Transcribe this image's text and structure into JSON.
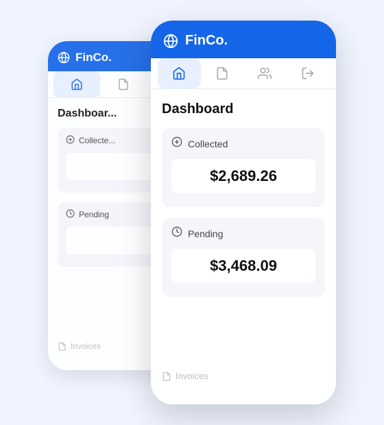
{
  "app": {
    "name": "FinCo.",
    "accent_color": "#1565e8"
  },
  "nav": {
    "items": [
      {
        "label": "home",
        "icon": "home",
        "active": true
      },
      {
        "label": "documents",
        "icon": "documents",
        "active": false
      },
      {
        "label": "users",
        "icon": "users",
        "active": false
      },
      {
        "label": "logout",
        "icon": "logout",
        "active": false
      }
    ]
  },
  "dashboard": {
    "title": "Dashboard",
    "cards": [
      {
        "label": "Collected",
        "icon": "dollar-circle",
        "value": "$2,689.26"
      },
      {
        "label": "Pending",
        "icon": "clock",
        "value": "$3,468.09"
      }
    ],
    "bottom_nav_label": "Invoices"
  }
}
